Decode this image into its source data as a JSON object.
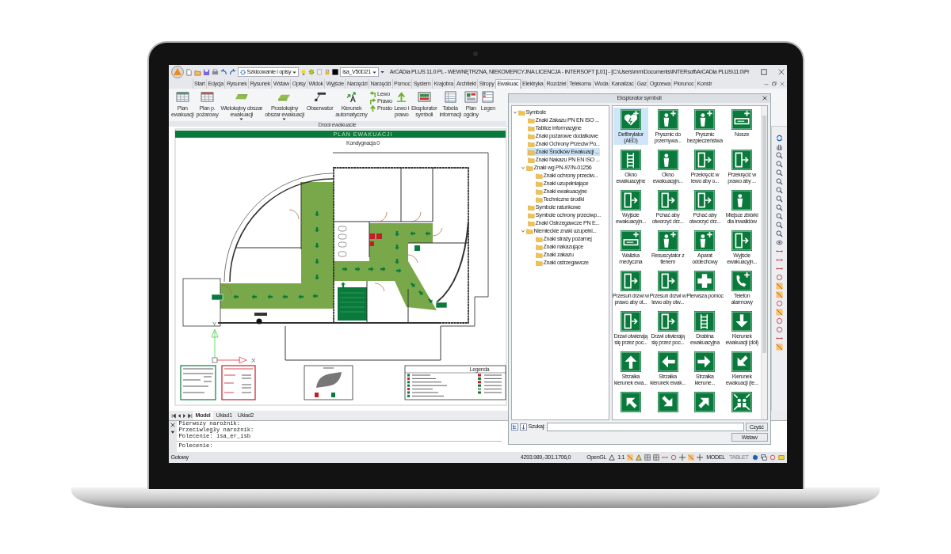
{
  "window": {
    "title": "ArCADia PLUS 11.0 PL - WEWNĘTRZNA, NIEKOMERCYJNA LICENCJA - INTERSOFT [L01] - [C:\\Users\\mm\\Documents\\INTERsoft\\ArCADia PLUS\\11.0\\Pr"
  },
  "quick_access": {
    "workspace": "Szkicowanie i opisy",
    "style": "isa_V50D21"
  },
  "ribbon_tabs": [
    {
      "label": "Start",
      "selected": false
    },
    {
      "label": "Edycja",
      "selected": false
    },
    {
      "label": "Rysunek",
      "selected": false
    },
    {
      "label": "Rysunek",
      "selected": false
    },
    {
      "label": "Wstaw",
      "selected": false
    },
    {
      "label": "Opisy",
      "selected": false
    },
    {
      "label": "Widok",
      "selected": false
    },
    {
      "label": "Wyjście",
      "selected": false
    },
    {
      "label": "Narzędzi",
      "selected": false
    },
    {
      "label": "Narzędzi",
      "selected": false
    },
    {
      "label": "Pomoc",
      "selected": false
    },
    {
      "label": "System",
      "selected": false
    },
    {
      "label": "Krajobra",
      "selected": false
    },
    {
      "label": "Architekt",
      "selected": false
    },
    {
      "label": "Stropy",
      "selected": false
    },
    {
      "label": "Ewakuac",
      "selected": true
    },
    {
      "label": "Elektryka",
      "selected": false
    },
    {
      "label": "Rozdziel",
      "selected": false
    },
    {
      "label": "Telekomu",
      "selected": false
    },
    {
      "label": "Woda",
      "selected": false
    },
    {
      "label": "Kanalizac",
      "selected": false
    },
    {
      "label": "Gaz",
      "selected": false
    },
    {
      "label": "Ogrzewa",
      "selected": false
    },
    {
      "label": "Piorunoc",
      "selected": false
    },
    {
      "label": "Konstr",
      "selected": false
    }
  ],
  "ribbon": {
    "group": "Drogi ewakuacje",
    "buttons": [
      {
        "kind": "large",
        "label": "Plan\newakuacji",
        "dropdown": false
      },
      {
        "kind": "large",
        "label": "Plan p.\npożarowy",
        "dropdown": false
      },
      {
        "kind": "large",
        "label": "Wielokątny obszar\newakuacji",
        "dropdown": true
      },
      {
        "kind": "large",
        "label": "Prostokątny\nobszar ewakuacji",
        "dropdown": true
      },
      {
        "kind": "large",
        "label": "Obserwator",
        "dropdown": false
      },
      {
        "kind": "large",
        "label": "Kierunek\nautomatyczny",
        "dropdown": false
      },
      {
        "kind": "small",
        "label": "Lewo"
      },
      {
        "kind": "small",
        "label": "Prawo"
      },
      {
        "kind": "small",
        "label": "Prosto"
      },
      {
        "kind": "large",
        "label": "Lewo i\nprawo",
        "dropdown": false
      },
      {
        "kind": "large",
        "label": "Eksplorator\nsymboli",
        "dropdown": false
      },
      {
        "kind": "large",
        "label": "Tabela\ninformacji",
        "dropdown": false
      },
      {
        "kind": "large",
        "label": "Plan\nogólny",
        "dropdown": false
      },
      {
        "kind": "large",
        "label": "Legen",
        "dropdown": false
      }
    ]
  },
  "drawing": {
    "title": "PLAN EWAKUACJI",
    "floor": "Kondygnacja 0",
    "legend_title": "Legenda",
    "axis_x": "X",
    "axis_y": "Y"
  },
  "layout_tabs": [
    {
      "label": "Model",
      "selected": true
    },
    {
      "label": "Układ1",
      "selected": false
    },
    {
      "label": "Układ2",
      "selected": false
    }
  ],
  "command": {
    "history": [
      "Pierwszy narożnik:",
      "Przeciwległy narożnik:",
      "Polecenie: isa_er_isb"
    ],
    "prompt": "Polecenie:"
  },
  "status": {
    "message": "Gotowy",
    "coordinates": "4293.989,-301.1706,0",
    "render": "OpenGL",
    "scale": "1:1",
    "toggles": [
      {
        "label": "MODEL",
        "disabled": false
      },
      {
        "label": "TABLET",
        "disabled": true
      }
    ]
  },
  "explorer": {
    "title": "Eksplorator symboli",
    "tree": [
      {
        "label": "Symbole",
        "expanded": true,
        "selected": false,
        "children": [
          {
            "label": "Znaki Zakazu PN EN ISO ...",
            "selected": false
          },
          {
            "label": "Tablice informacyjne",
            "selected": false
          },
          {
            "label": "Znaki pożarowe dodatkowe",
            "selected": false
          },
          {
            "label": "Znaki Ochrony Przeciw Po...",
            "selected": false
          },
          {
            "label": "Znaki Środków Ewakuacji ...",
            "selected": true
          },
          {
            "label": "Znaki Nakazu PN EN ISO ...",
            "selected": false
          },
          {
            "label": "Znaki wg PN-97/N-01256",
            "expanded": true,
            "selected": false,
            "children": [
              {
                "label": "Znaki ochrony przeciw...",
                "selected": false
              },
              {
                "label": "Znaki uzupełniające",
                "selected": false
              },
              {
                "label": "Znaki ewakuacyjne",
                "selected": false
              },
              {
                "label": "Techniczne środki",
                "selected": false
              }
            ]
          },
          {
            "label": "Symbole ratunkowe",
            "selected": false
          },
          {
            "label": "Symbole ochrony przeciwp...",
            "selected": false
          },
          {
            "label": "Znaki Ostrzegawcze PN E...",
            "selected": false
          },
          {
            "label": "Niemieckie znaki uzupełni...",
            "expanded": true,
            "selected": false,
            "children": [
              {
                "label": "Znaki straży pożarnej",
                "selected": false
              },
              {
                "label": "Znaki nakazujące",
                "selected": false
              },
              {
                "label": "Znaki zakazu",
                "selected": false
              },
              {
                "label": "Znaki ostrzegawcze",
                "selected": false
              }
            ]
          }
        ]
      }
    ],
    "symbols": [
      {
        "label": "Defibrylator\n(AED)",
        "selected": true
      },
      {
        "label": "Prysznic do\nprzemywa...",
        "selected": false
      },
      {
        "label": "Prysznic\nbezpieczeństwa",
        "selected": false
      },
      {
        "label": "Nosze",
        "selected": false
      },
      {
        "label": "Okno\newakuacyjne",
        "selected": false
      },
      {
        "label": "Okno\newakuacyjn...",
        "selected": false
      },
      {
        "label": "Przekręcić w\nlewo aby o...",
        "selected": false
      },
      {
        "label": "Przekręcić w\nprawo aby ...",
        "selected": false
      },
      {
        "label": "Wyjście\newakuacyjn...",
        "selected": false
      },
      {
        "label": "Pchać aby\notworzyć drz...",
        "selected": false
      },
      {
        "label": "Pchać aby\notworzyć drz...",
        "selected": false
      },
      {
        "label": "Miejsce zbiórki\ndla inwalidów",
        "selected": false
      },
      {
        "label": "Walizka\nmedyczna",
        "selected": false
      },
      {
        "label": "Resuscytator z\ntlenem",
        "selected": false
      },
      {
        "label": "Aparat\noddechowy",
        "selected": false
      },
      {
        "label": "Wyjście\newakuacyjn...",
        "selected": false
      },
      {
        "label": "Przesuń drzwi w\nprawo aby ot...",
        "selected": false
      },
      {
        "label": "Przesuń drzwi w\nlewo aby otw...",
        "selected": false
      },
      {
        "label": "Pierwsza pomoc",
        "selected": false
      },
      {
        "label": "Telefon\nalarmowy",
        "selected": false
      },
      {
        "label": "Drzwi otwierają\nsię przez poc...",
        "selected": false
      },
      {
        "label": "Drzwi otwierają\nsię przez poc...",
        "selected": false
      },
      {
        "label": "Drabina\newakuacyjna",
        "selected": false
      },
      {
        "label": "Kierunek\newakuacji (dół)",
        "selected": false
      },
      {
        "label": "Strzałka\nkierunek ewa...",
        "selected": false
      },
      {
        "label": "Strzałka\nkierunek ewak...",
        "selected": false
      },
      {
        "label": "Strzałka\nkierune...",
        "selected": false
      },
      {
        "label": "Kierunek\newakuacji (le...",
        "selected": false
      },
      {
        "selected": false
      },
      {
        "selected": false
      },
      {
        "selected": false
      },
      {
        "selected": false
      }
    ],
    "search": {
      "label": "Szukaj:",
      "clear": "Czyść",
      "insert": "Wstaw"
    }
  }
}
